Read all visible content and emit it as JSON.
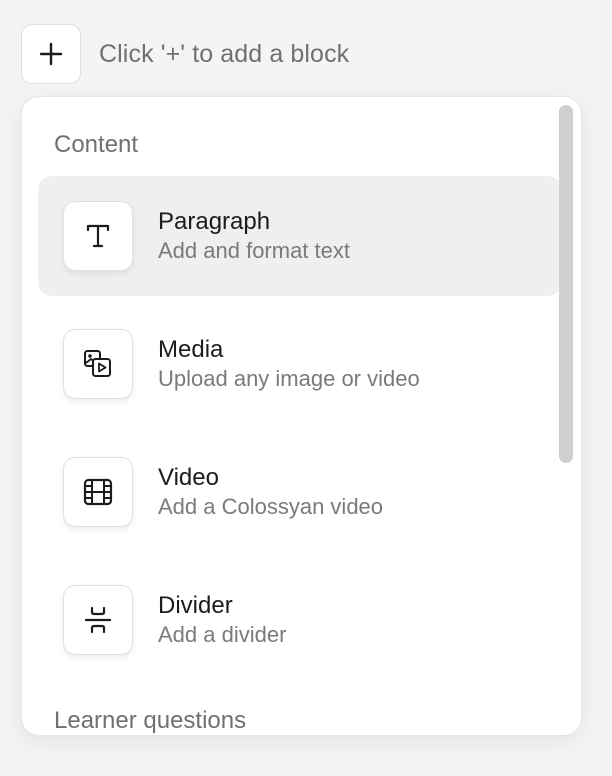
{
  "add_block": {
    "hint": "Click '+' to add a block",
    "button_icon": "plus-icon"
  },
  "sections": {
    "content_label": "Content",
    "learner_label": "Learner questions"
  },
  "items": [
    {
      "title": "Paragraph",
      "description": "Add and format text",
      "icon": "text-t-icon",
      "active": true
    },
    {
      "title": "Media",
      "description": "Upload any image or video",
      "icon": "media-icon",
      "active": false
    },
    {
      "title": "Video",
      "description": "Add a Colossyan video",
      "icon": "film-icon",
      "active": false
    },
    {
      "title": "Divider",
      "description": "Add a divider",
      "icon": "divider-icon",
      "active": false
    }
  ],
  "colors": {
    "background": "#f4f4f4",
    "panel": "#ffffff",
    "active_row": "#efefef",
    "text_primary": "#1c1c1c",
    "text_secondary": "#707070",
    "scrollbar": "#cfcfcf"
  }
}
